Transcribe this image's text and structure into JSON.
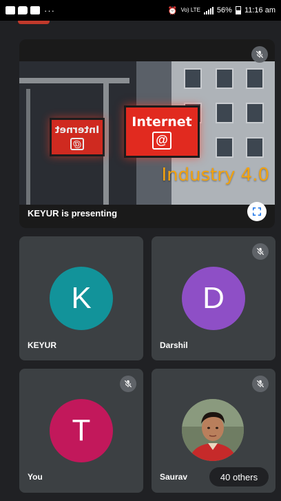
{
  "status_bar": {
    "more_indicator": "···",
    "network_label": "Vo) LTE",
    "battery_percent": "56%",
    "time": "11:16 am"
  },
  "presentation": {
    "presenter_label": "KEYUR is presenting",
    "slide_sign_text": "Internet",
    "slide_sign_symbol": "@",
    "slide_sign_small_text": "Internet",
    "slide_overlay_text": "Industry 4.0",
    "overlay_color": "#f2a20f"
  },
  "participants": [
    {
      "name": "KEYUR",
      "initial": "K",
      "color": "#12939a",
      "muted": false
    },
    {
      "name": "Darshil",
      "initial": "D",
      "color": "#8e4fc6",
      "muted": true
    },
    {
      "name": "You",
      "initial": "T",
      "color": "#c2185b",
      "muted": true
    },
    {
      "name": "Saurav",
      "initial": "",
      "color": "",
      "muted": true,
      "photo": true
    }
  ],
  "others_count_label": "40 others",
  "icons": {
    "mute": "mic-off-icon",
    "fullscreen": "fullscreen-icon"
  }
}
